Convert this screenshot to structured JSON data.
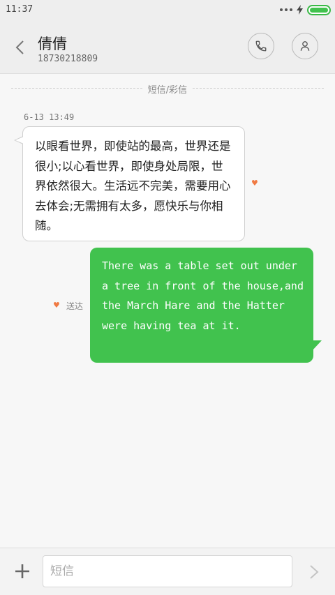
{
  "status_bar": {
    "time": "11:37"
  },
  "header": {
    "contact_name": "倩倩",
    "contact_number": "18730218809"
  },
  "thread": {
    "divider_label": "短信/彩信",
    "timestamp": "6-13 13:49",
    "messages": [
      {
        "direction": "incoming",
        "text": "以眼看世界，即使站的最高，世界还是很小;以心看世界，即使身处局限，世界依然很大。生活远不完美，需要用心去体会;无需拥有太多，愿快乐与你相随。"
      },
      {
        "direction": "outgoing",
        "text": "There was a table set out under a tree in front of the house,and the March Hare and the Hatter were having tea at it.",
        "status": "送达"
      }
    ]
  },
  "composer": {
    "placeholder": "短信"
  },
  "colors": {
    "outgoing_bubble": "#41c24e",
    "heart": "#f07a43",
    "battery": "#41c24e"
  },
  "icons": [
    "back-icon",
    "phone-icon",
    "person-icon",
    "heart-icon",
    "plus-icon",
    "send-icon"
  ]
}
